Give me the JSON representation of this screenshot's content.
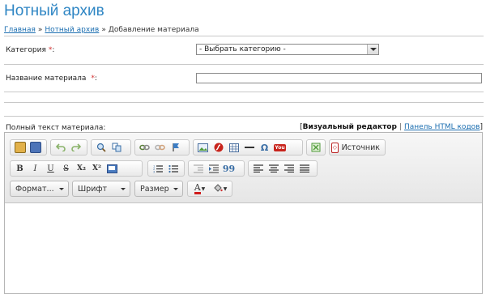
{
  "page_title": "Нотный архив",
  "breadcrumb": {
    "items": [
      "Главная",
      "Нотный архив"
    ],
    "current": "Добавление материала",
    "separator": "»"
  },
  "form": {
    "category": {
      "label": "Категория",
      "required_mark": "*",
      "value": "- Выбрать категорию -"
    },
    "name": {
      "label": "Название материала",
      "required_mark": "*",
      "value": ""
    },
    "fulltext": {
      "label": "Полный текст материала:"
    }
  },
  "editor_modes": {
    "open_bracket": "[",
    "active": "Визуальный редактор",
    "separator": "|",
    "other": "Панель HTML кодов",
    "close_bracket": "]"
  },
  "toolbar": {
    "source_label": "Источник",
    "format_label": "Формат...",
    "font_label": "Шрифт",
    "size_label": "Размер",
    "bold": "B",
    "italic": "I",
    "underline": "U",
    "strike": "S",
    "subscript": "X₂",
    "superscript": "X²",
    "quote": "99",
    "omega": "Ω",
    "youtube": "You",
    "text_color": "A"
  },
  "colors": {
    "title": "#2f86c4",
    "link": "#1d6fb1",
    "required": "#d32f2f"
  }
}
